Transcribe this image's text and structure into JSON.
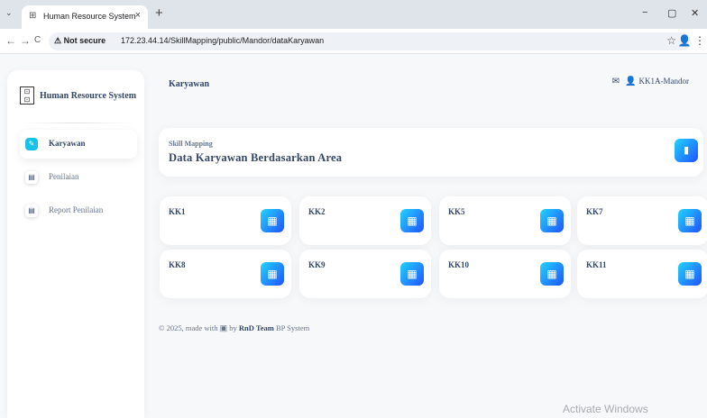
{
  "browser": {
    "tab_title": "Human Resource System",
    "tab_close": "×",
    "new_tab": "+",
    "tab_dropdown": "⌄",
    "minimize": "−",
    "maximize": "▢",
    "close": "✕",
    "back": "←",
    "forward": "→",
    "reload": "C",
    "security_label": "⚠ Not secure",
    "url": "172.23.44.14/SkillMapping/public/Mandor/dataKaryawan",
    "star": "☆",
    "account": "👤  ⋮"
  },
  "sidebar": {
    "brand": "Human Resource System",
    "items": [
      {
        "label": "Karyawan",
        "active": true
      },
      {
        "label": "Penilaian",
        "active": false
      },
      {
        "label": "Report Penilaian",
        "active": false
      }
    ]
  },
  "topbar": {
    "page_title": "Karyawan",
    "user": "KK1A-Mandor"
  },
  "header": {
    "subtitle": "Skill Mapping",
    "title": "Data Karyawan Berdasarkan Area"
  },
  "areas": [
    {
      "label": "KK1"
    },
    {
      "label": "KK2"
    },
    {
      "label": "KK5"
    },
    {
      "label": "KK7"
    },
    {
      "label": "KK8"
    },
    {
      "label": "KK9"
    },
    {
      "label": "KK10"
    },
    {
      "label": "KK11"
    }
  ],
  "footer": {
    "prefix": "© 2025, made with",
    "by": "by",
    "team": "RnD Team",
    "suffix": "BP System"
  },
  "watermark": "Activate Windows",
  "colors": {
    "accent_gradient_start": "#2152ff",
    "accent_gradient_end": "#21d4fd",
    "active_icon": "#17c1e8",
    "text_primary": "#344767",
    "text_muted": "#67748e"
  }
}
